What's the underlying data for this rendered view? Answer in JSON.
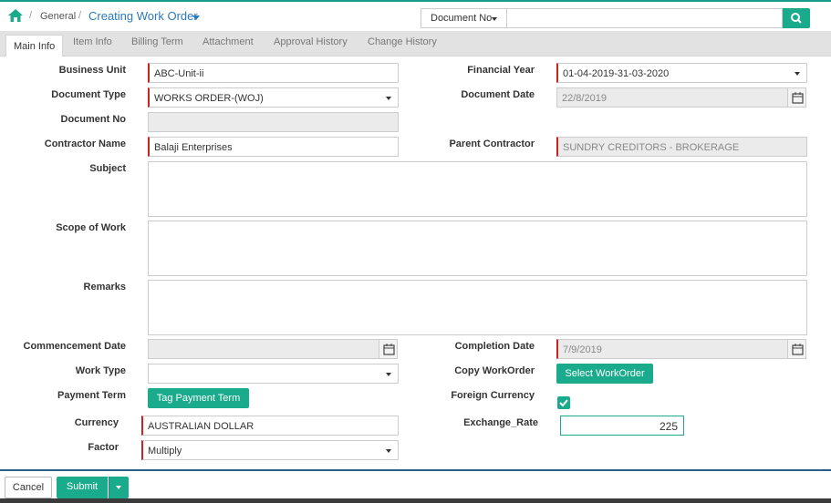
{
  "breadcrumb": {
    "separator": "/",
    "parent": "General",
    "current": "Creating Work Order"
  },
  "doc_search": {
    "dropdown_label": "Document No",
    "input_value": ""
  },
  "tabs": [
    {
      "label": "Main Info"
    },
    {
      "label": "Item Info"
    },
    {
      "label": "Billing Term"
    },
    {
      "label": "Attachment"
    },
    {
      "label": "Approval History"
    },
    {
      "label": "Change History"
    }
  ],
  "form": {
    "business_unit": {
      "label": "Business Unit",
      "value": "ABC-Unit-ii"
    },
    "financial_year": {
      "label": "Financial Year",
      "value": "01-04-2019-31-03-2020"
    },
    "document_type": {
      "label": "Document Type",
      "value": "WORKS ORDER-(WOJ)"
    },
    "document_date": {
      "label": "Document Date",
      "value": "22/8/2019"
    },
    "document_no": {
      "label": "Document No",
      "value": ""
    },
    "contractor_name": {
      "label": "Contractor Name",
      "value": "Balaji Enterprises"
    },
    "parent_contractor": {
      "label": "Parent Contractor",
      "value": "SUNDRY CREDITORS - BROKERAGE"
    },
    "subject": {
      "label": "Subject",
      "value": ""
    },
    "scope_of_work": {
      "label": "Scope of Work",
      "value": ""
    },
    "remarks": {
      "label": "Remarks",
      "value": ""
    },
    "commencement_date": {
      "label": "Commencement Date",
      "value": ""
    },
    "completion_date": {
      "label": "Completion Date",
      "value": "7/9/2019"
    },
    "work_type": {
      "label": "Work Type",
      "value": ""
    },
    "copy_workorder": {
      "label": "Copy WorkOrder",
      "button": "Select WorkOrder"
    },
    "payment_term": {
      "label": "Payment Term",
      "button": "Tag Payment Term"
    },
    "foreign_currency": {
      "label": "Foreign Currency",
      "checked": true
    },
    "currency": {
      "label": "Currency",
      "value": "AUSTRALIAN DOLLAR"
    },
    "exchange_rate": {
      "label": "Exchange_Rate",
      "value": "225"
    },
    "factor": {
      "label": "Factor",
      "value": "Multiply"
    }
  },
  "footer": {
    "cancel_label": "Cancel",
    "submit_label": "Submit"
  },
  "colors": {
    "accent": "#1aaa8c",
    "required_marker": "#cc2222",
    "link": "#2a7ab8"
  }
}
